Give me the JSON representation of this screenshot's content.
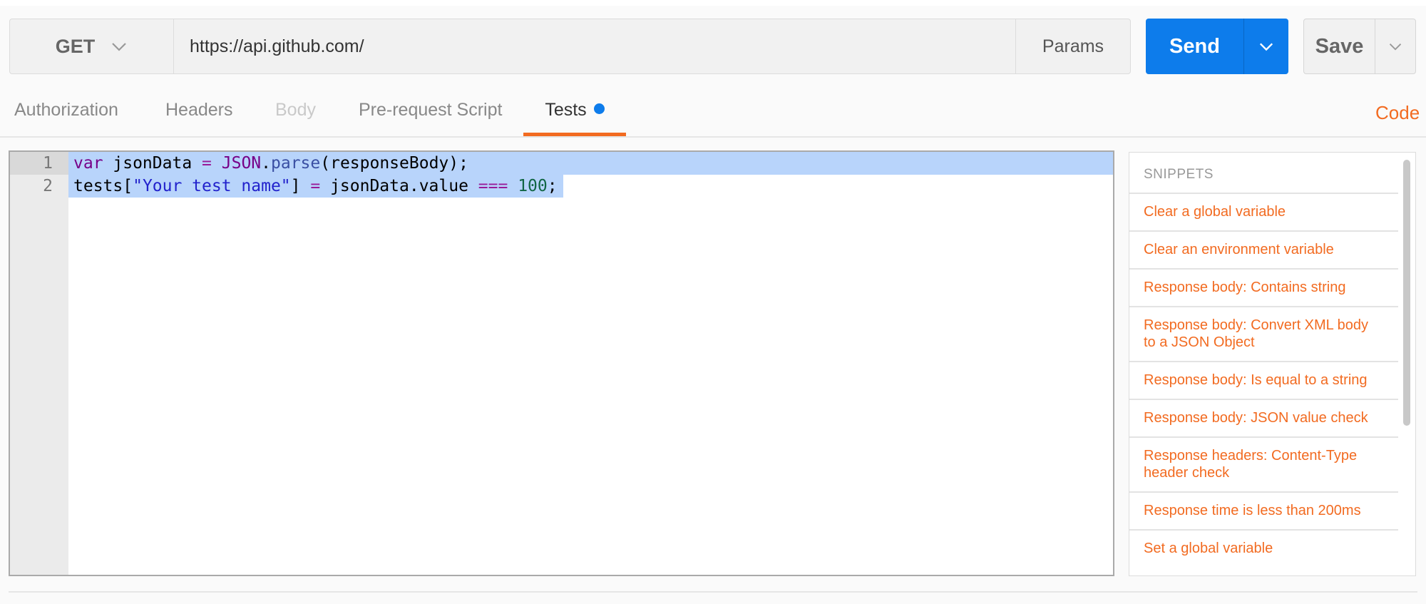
{
  "request": {
    "method": "GET",
    "url": "https://api.github.com/",
    "params_label": "Params",
    "send_label": "Send",
    "save_label": "Save"
  },
  "tabs": [
    {
      "label": "Authorization",
      "state": "normal"
    },
    {
      "label": "Headers",
      "state": "normal"
    },
    {
      "label": "Body",
      "state": "disabled"
    },
    {
      "label": "Pre-request Script",
      "state": "normal"
    },
    {
      "label": "Tests",
      "state": "active"
    }
  ],
  "code_link": "Code",
  "editor": {
    "line_numbers": [
      "1",
      "2"
    ],
    "lines": [
      "var jsonData = JSON.parse(responseBody);",
      "tests[\"Your test name\"] = jsonData.value === 100;"
    ]
  },
  "snippets": {
    "title": "SNIPPETS",
    "items": [
      "Clear a global variable",
      "Clear an environment variable",
      "Response body: Contains string",
      "Response body: Convert XML body to a JSON Object",
      "Response body: Is equal to a string",
      "Response body: JSON value check",
      "Response headers: Content-Type header check",
      "Response time is less than 200ms",
      "Set a global variable"
    ]
  },
  "colors": {
    "accent_orange": "#f26b21",
    "send_blue": "#0d7ceb",
    "selection": "#b8d4fb"
  },
  "icons": {
    "method_dropdown": "chevron-down-icon",
    "send_dropdown": "chevron-down-icon",
    "save_dropdown": "chevron-down-icon",
    "tests_indicator": "dot-icon"
  }
}
